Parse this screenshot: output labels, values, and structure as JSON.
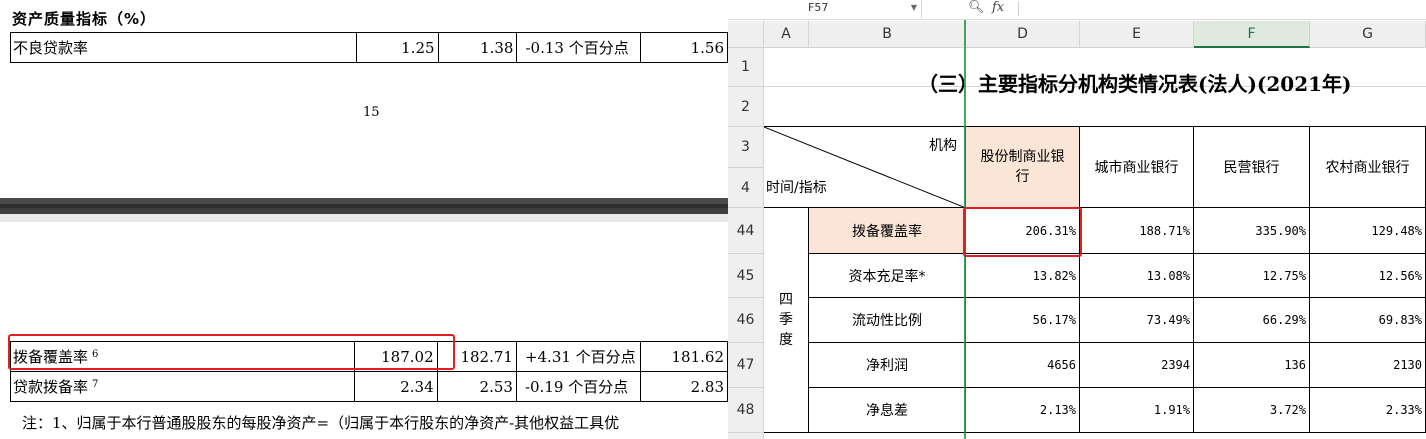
{
  "doc": {
    "section_title": "资产质量指标（%）",
    "top_row": {
      "label": "不良贷款率",
      "v1": "1.25",
      "v2": "1.38",
      "change": "-0.13 个百分点",
      "v3": "1.56"
    },
    "page_number": "15",
    "rows": [
      {
        "label": "拨备覆盖率",
        "sup": "6",
        "v1": "187.02",
        "v2": "182.71",
        "change": "+4.31 个百分点",
        "v3": "181.62"
      },
      {
        "label": "贷款拨备率",
        "sup": "7",
        "v1": "2.34",
        "v2": "2.53",
        "change": "-0.19 个百分点",
        "v3": "2.83"
      }
    ],
    "note": "注：1、归属于本行普通股股东的每股净资产=（归属于本行股东的净资产-其他权益工具优"
  },
  "sheet": {
    "name_box": "F57",
    "zoom_icon": "zoom-icon",
    "fx_label": "fx",
    "columns": [
      "A",
      "B",
      "D",
      "E",
      "F",
      "G"
    ],
    "selected_column": "F",
    "row_numbers": [
      "1",
      "2",
      "3",
      "4",
      "44",
      "45",
      "46",
      "47",
      "48"
    ],
    "title": "（三）主要指标分机构类情况表(法人)(2021年)",
    "header_org": "机构",
    "header_time": "时间/指标",
    "col_headers": [
      "股份制商业银行",
      "城市商业银行",
      "民营银行",
      "农村商业银行"
    ],
    "period": "四季度",
    "indicators": [
      {
        "name": "拨备覆盖率",
        "values": [
          "206.31%",
          "188.71%",
          "335.90%",
          "129.48%"
        ]
      },
      {
        "name": "资本充足率*",
        "values": [
          "13.82%",
          "13.08%",
          "12.75%",
          "12.56%"
        ]
      },
      {
        "name": "流动性比例",
        "values": [
          "56.17%",
          "73.49%",
          "66.29%",
          "69.83%"
        ]
      },
      {
        "name": "净利润",
        "values": [
          "4656",
          "2394",
          "136",
          "2130"
        ]
      },
      {
        "name": "净息差",
        "values": [
          "2.13%",
          "1.91%",
          "3.72%",
          "2.33%"
        ]
      }
    ],
    "colors": {
      "highlight": "#fbe5d6",
      "accent_green": "#217346",
      "annotation_red": "#e02020"
    }
  }
}
